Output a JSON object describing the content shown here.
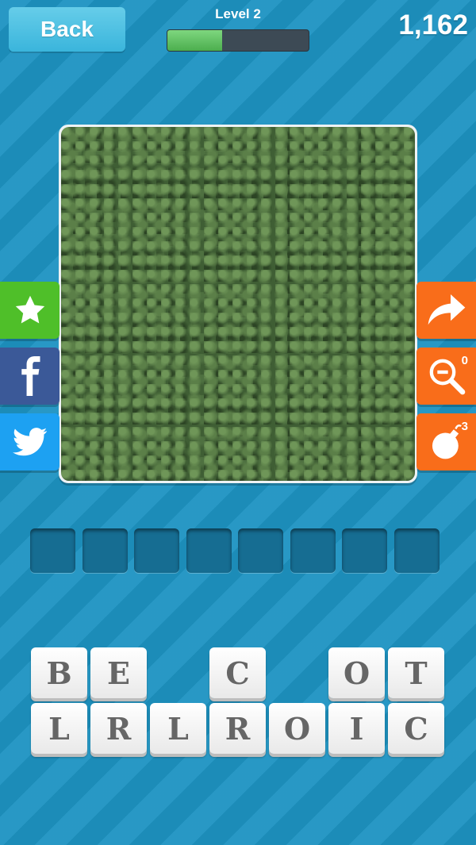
{
  "header": {
    "back_label": "Back",
    "level_label": "Level 2",
    "level_progress": 0.39,
    "score": "1,162"
  },
  "puzzle": {
    "image_subject": "broccoli-closeup"
  },
  "side_buttons": {
    "left": [
      "star-icon",
      "facebook-icon",
      "twitter-icon"
    ],
    "right": [
      "skip-arrow-icon",
      "zoom-out-icon",
      "bomb-icon"
    ],
    "zoom_count": "0",
    "bomb_count": "3"
  },
  "answer": {
    "slot_count": 8
  },
  "letters": {
    "row1": [
      "B",
      "E",
      "",
      "C",
      "",
      "O",
      "T"
    ],
    "row2": [
      "L",
      "R",
      "L",
      "R",
      "O",
      "I",
      "C"
    ]
  },
  "colors": {
    "background": "#1d93c2",
    "progress_fill": "#4cae4e",
    "share_green": "#4fbf29",
    "facebook_blue": "#3b5998",
    "twitter_blue": "#1da1f2",
    "powerup_orange": "#f96d1a"
  }
}
